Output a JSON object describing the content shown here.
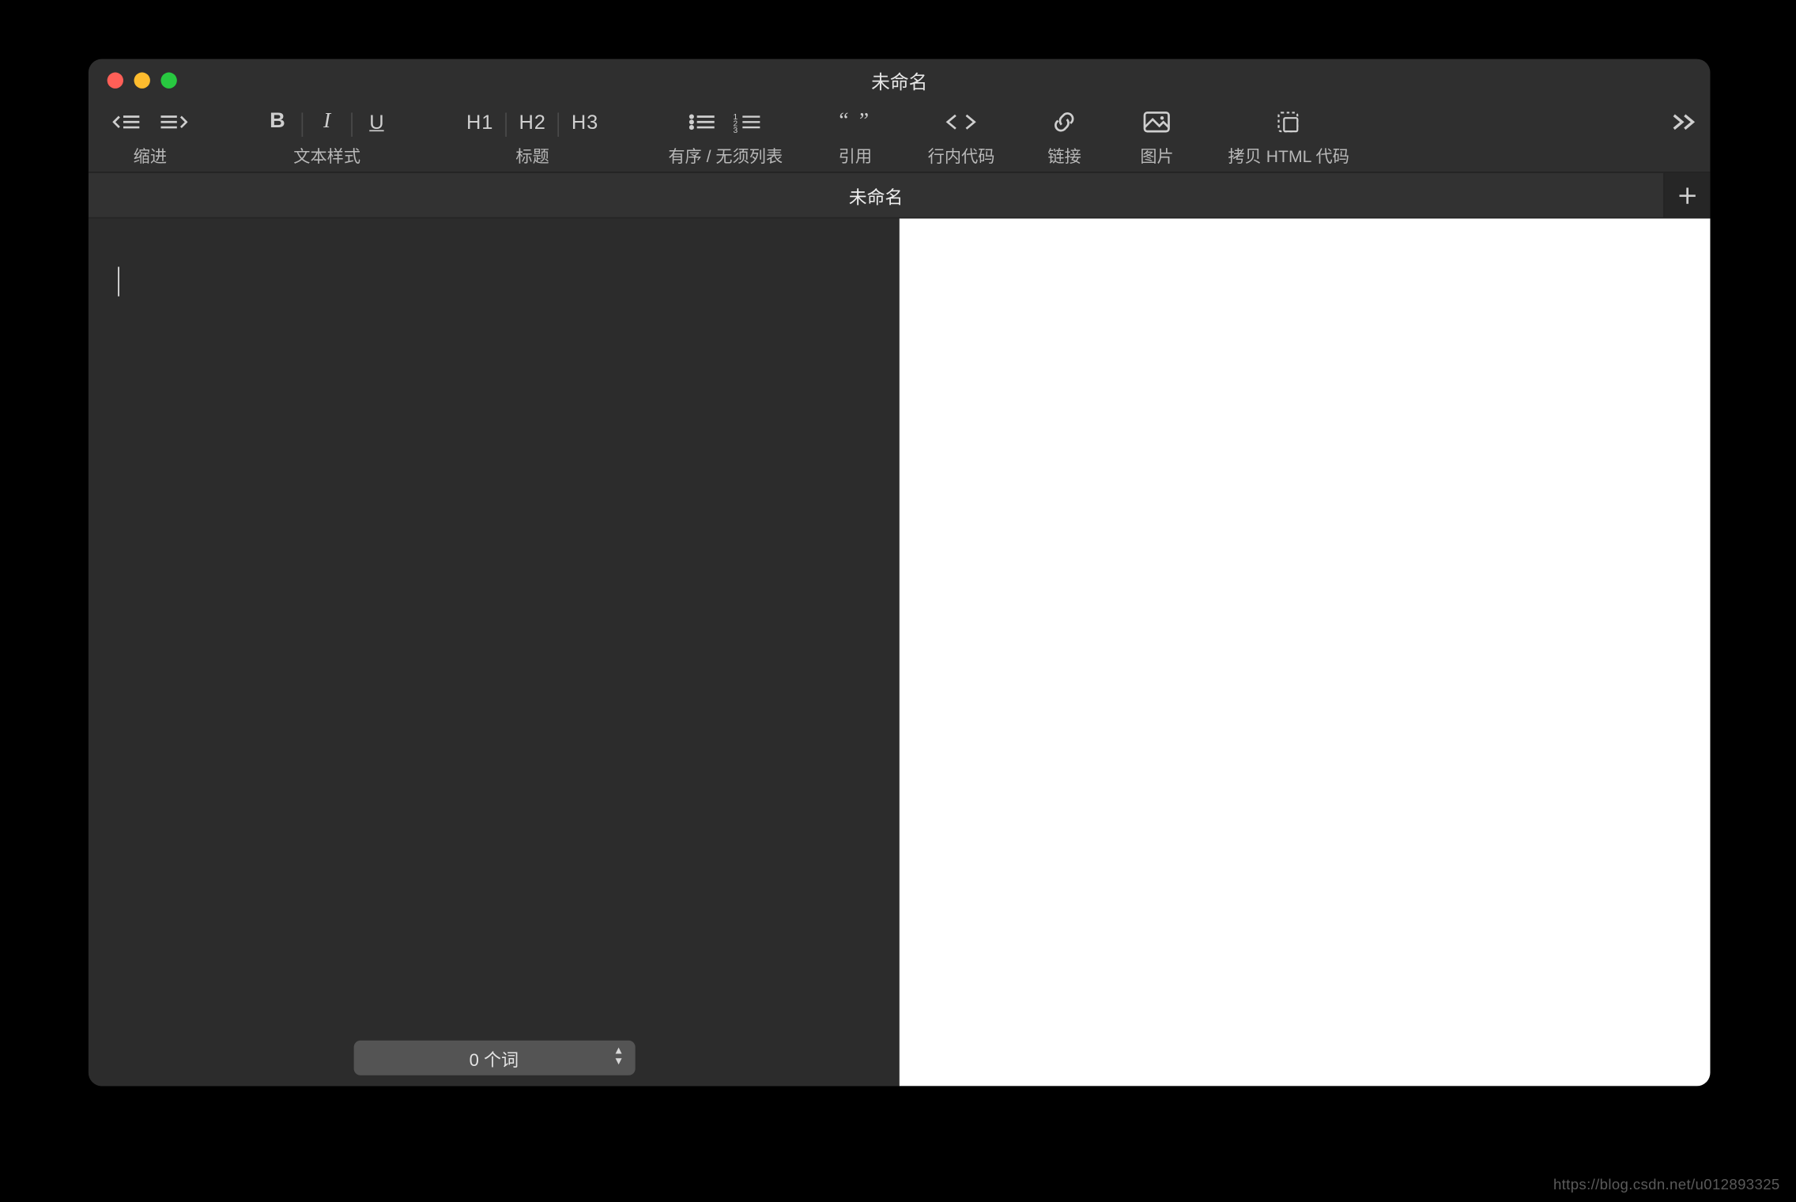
{
  "window": {
    "title": "未命名"
  },
  "toolbar": {
    "indent": {
      "label": "缩进"
    },
    "textstyle": {
      "label": "文本样式",
      "bold": "B",
      "italic": "I",
      "underline": "U"
    },
    "heading": {
      "label": "标题",
      "h1": "H1",
      "h2": "H2",
      "h3": "H3"
    },
    "list": {
      "label": "有序 / 无须列表"
    },
    "quote": {
      "label": "引用"
    },
    "code": {
      "label": "行内代码"
    },
    "link": {
      "label": "链接"
    },
    "image": {
      "label": "图片"
    },
    "copyhtml": {
      "label": "拷贝 HTML 代码"
    }
  },
  "tabs": {
    "items": [
      {
        "label": "未命名"
      }
    ]
  },
  "statusbar": {
    "wordcount": "0 个词"
  },
  "watermark": "https://blog.csdn.net/u012893325"
}
